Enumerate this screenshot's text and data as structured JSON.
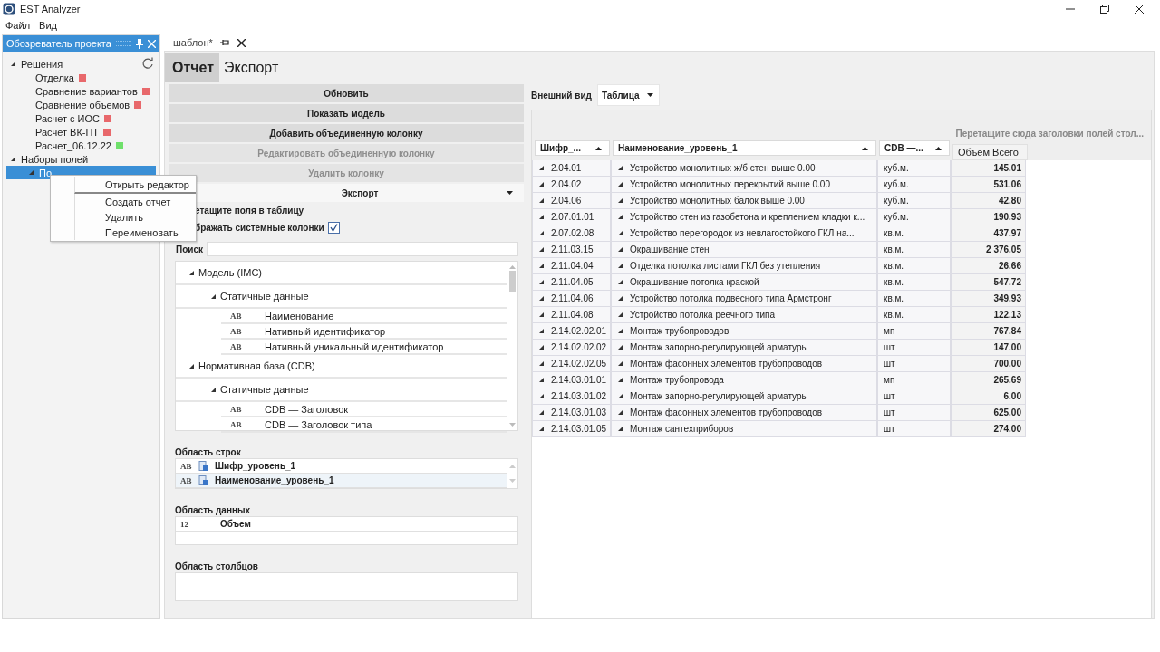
{
  "window": {
    "title": "EST Analyzer"
  },
  "menu": [
    "Файл",
    "Вид"
  ],
  "project_panel": {
    "title": "Обозреватель проекта",
    "tree": [
      {
        "label": "Решения",
        "expanded": true,
        "selected": false,
        "children": [
          {
            "label": "Отделка",
            "color": "#e8686b",
            "selected": false
          },
          {
            "label": "Сравнение вариантов",
            "color": "#e8686b",
            "selected": false
          },
          {
            "label": "Сравнение объемов",
            "color": "#e8686b",
            "selected": false
          },
          {
            "label": "Расчет с ИОС",
            "color": "#e8686b",
            "selected": false
          },
          {
            "label": "Расчет ВК-ПТ",
            "color": "#e8686b",
            "selected": false
          },
          {
            "label": "Расчет_06.12.22",
            "color": "#6fe06b",
            "selected": false
          }
        ]
      },
      {
        "label": "Наборы полей",
        "expanded": true,
        "selected": false,
        "children": [
          {
            "label": "По",
            "expanded": true,
            "selected": true
          }
        ]
      }
    ]
  },
  "context_menu": [
    {
      "label": "Открыть редактор",
      "selected": true
    },
    {
      "label": "Создать отчет",
      "selected": false
    },
    {
      "label": "Удалить",
      "selected": false
    },
    {
      "label": "Переименовать",
      "selected": false
    }
  ],
  "document_tab": {
    "title": "шаблон*"
  },
  "view_tabs": [
    {
      "label": "Отчет",
      "selected": true
    },
    {
      "label": "Экспорт",
      "selected": false
    }
  ],
  "actions": [
    {
      "label": "Обновить",
      "disabled": false
    },
    {
      "label": "Показать модель",
      "disabled": false
    },
    {
      "label": "Добавить объединенную колонку",
      "disabled": false
    },
    {
      "label": "Редактировать объединенную колонку",
      "disabled": true
    },
    {
      "label": "Удалить колонку",
      "disabled": true
    }
  ],
  "export_dropdown": {
    "label": "Экспорт"
  },
  "hint": "етащите поля в таблицу",
  "system_columns": {
    "label": "бражать системные колонки",
    "checked": true
  },
  "search": {
    "label": "Поиск"
  },
  "field_tree": [
    {
      "label": "Модель (IMC)",
      "expanded": true,
      "children": [
        {
          "label": "Статичные данные",
          "expanded": true,
          "children": [
            {
              "type_label": "AB",
              "label": "Наименование"
            },
            {
              "type_label": "AB",
              "label": "Нативный идентификатор"
            },
            {
              "type_label": "AB",
              "label": "Нативный уникальный идентификатор"
            }
          ]
        }
      ]
    },
    {
      "label": "Нормативная база (CDB)",
      "expanded": true,
      "children": [
        {
          "label": "Статичные данные",
          "expanded": true,
          "children": [
            {
              "type_label": "AB",
              "label": "CDB — Заголовок"
            },
            {
              "type_label": "AB",
              "label": "CDB — Заголовок типа"
            }
          ]
        }
      ]
    }
  ],
  "row_area": {
    "label": "Область строк",
    "items": [
      {
        "type_label": "AB",
        "label": "Шифр_уровень_1",
        "selected": false
      },
      {
        "type_label": "AB",
        "label": "Наименование_уровень_1",
        "selected": true
      }
    ]
  },
  "data_area": {
    "label": "Область данных",
    "items": [
      {
        "type_label": "12",
        "label": "Объем"
      }
    ]
  },
  "column_area": {
    "label": "Область столбцов"
  },
  "appearance": {
    "label": "Внешний вид",
    "value": "Таблица"
  },
  "pivot": {
    "drop_hint": "Перетащите сюда заголовки полей стол...",
    "row_headers": [
      "Шифр_...",
      "Наименование_уровень_1",
      "CDB —..."
    ],
    "data_header": "Объем Всего",
    "rows": [
      {
        "code": "2.04.01",
        "name": "Устройство монолитных ж/б стен выше 0.00",
        "unit": "куб.м.",
        "value": "145.01"
      },
      {
        "code": "2.04.02",
        "name": "Устройство монолитных перекрытий выше 0.00",
        "unit": "куб.м.",
        "value": "531.06"
      },
      {
        "code": "2.04.06",
        "name": "Устройство монолитных балок выше 0.00",
        "unit": "куб.м.",
        "value": "42.80"
      },
      {
        "code": "2.07.01.01",
        "name": "Устройство стен из газобетона и креплением кладки к...",
        "unit": "куб.м.",
        "value": "190.93"
      },
      {
        "code": "2.07.02.08",
        "name": "Устройство перегородок из невлагостойкого ГКЛ на...",
        "unit": "кв.м.",
        "value": "437.97"
      },
      {
        "code": "2.11.03.15",
        "name": "Окрашивание стен",
        "unit": "кв.м.",
        "value": "2 376.05"
      },
      {
        "code": "2.11.04.04",
        "name": "Отделка потолка листами ГКЛ без утепления",
        "unit": "кв.м.",
        "value": "26.66"
      },
      {
        "code": "2.11.04.05",
        "name": "Окрашивание потолка краской",
        "unit": "кв.м.",
        "value": "547.72"
      },
      {
        "code": "2.11.04.06",
        "name": "Устройство потолка подвесного типа Армстронг",
        "unit": "кв.м.",
        "value": "349.93"
      },
      {
        "code": "2.11.04.08",
        "name": "Устройство потолка реечного типа",
        "unit": "кв.м.",
        "value": "122.13"
      },
      {
        "code": "2.14.02.02.01",
        "name": "Монтаж трубопроводов",
        "unit": "мп",
        "value": "767.84"
      },
      {
        "code": "2.14.02.02.02",
        "name": "Монтаж запорно-регулирующей арматуры",
        "unit": "шт",
        "value": "147.00"
      },
      {
        "code": "2.14.02.02.05",
        "name": "Монтаж фасонных элементов трубопроводов",
        "unit": "шт",
        "value": "700.00"
      },
      {
        "code": "2.14.03.01.01",
        "name": "Монтаж трубопровода",
        "unit": "мп",
        "value": "265.69"
      },
      {
        "code": "2.14.03.01.02",
        "name": "Монтаж запорно-регулирующей арматуры",
        "unit": "шт",
        "value": "6.00"
      },
      {
        "code": "2.14.03.01.03",
        "name": "Монтаж фасонных элементов трубопроводов",
        "unit": "шт",
        "value": "625.00"
      },
      {
        "code": "2.14.03.01.05",
        "name": "Монтаж сантехприборов",
        "unit": "шт",
        "value": "274.00"
      }
    ]
  }
}
